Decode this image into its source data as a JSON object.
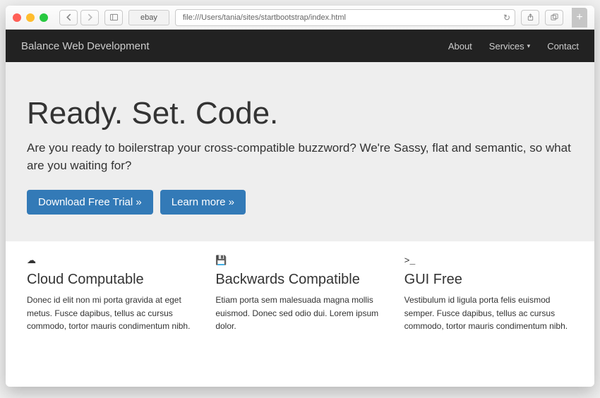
{
  "browser": {
    "tab_label": "ebay",
    "url": "file:///Users/tania/sites/startbootstrap/index.html"
  },
  "navbar": {
    "brand": "Balance Web Development",
    "links": {
      "about": "About",
      "services": "Services",
      "contact": "Contact"
    }
  },
  "jumbo": {
    "heading": "Ready. Set. Code.",
    "lead": "Are you ready to boilerstrap your cross-compatible buzzword? We're Sassy, flat and semantic, so what are you waiting for?",
    "primary_btn": "Download Free Trial »",
    "secondary_btn": "Learn more »"
  },
  "features": [
    {
      "icon": "☁",
      "title": "Cloud Computable",
      "text": "Donec id elit non mi porta gravida at eget metus. Fusce dapibus, tellus ac cursus commodo, tortor mauris condimentum nibh."
    },
    {
      "icon": "💾",
      "title": "Backwards Compatible",
      "text": "Etiam porta sem malesuada magna mollis euismod. Donec sed odio dui. Lorem ipsum dolor."
    },
    {
      "icon": ">_",
      "title": "GUI Free",
      "text": "Vestibulum id ligula porta felis euismod semper. Fusce dapibus, tellus ac cursus commodo, tortor mauris condimentum nibh."
    }
  ]
}
